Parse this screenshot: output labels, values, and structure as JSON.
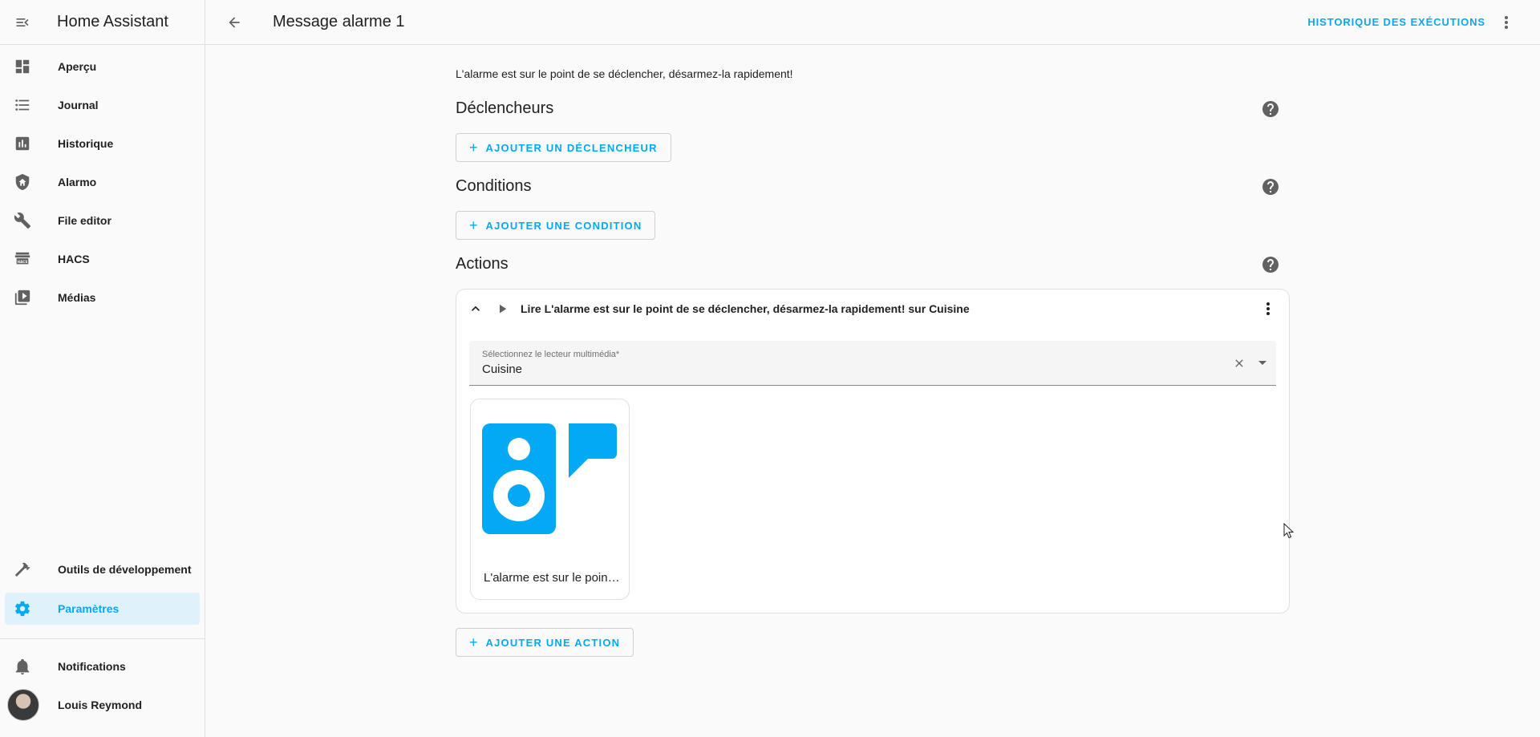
{
  "app": {
    "title": "Home Assistant"
  },
  "sidebar": {
    "items": [
      {
        "label": "Aperçu",
        "icon": "dashboard-icon"
      },
      {
        "label": "Journal",
        "icon": "list-icon"
      },
      {
        "label": "Historique",
        "icon": "chart-icon"
      },
      {
        "label": "Alarmo",
        "icon": "shield-home-icon"
      },
      {
        "label": "File editor",
        "icon": "wrench-icon"
      },
      {
        "label": "HACS",
        "icon": "hacs-store-icon"
      },
      {
        "label": "Médias",
        "icon": "play-box-icon"
      }
    ],
    "dev_tools": {
      "label": "Outils de développement",
      "icon": "hammer-icon"
    },
    "settings": {
      "label": "Paramètres",
      "icon": "gear-icon",
      "active": true
    },
    "notifications": {
      "label": "Notifications",
      "icon": "bell-icon"
    },
    "user": {
      "label": "Louis Reymond"
    }
  },
  "header": {
    "title": "Message alarme 1",
    "history_label": "HISTORIQUE DES EXÉCUTIONS"
  },
  "main": {
    "description": "L'alarme est sur le point de se déclencher, désarmez-la rapidement!",
    "triggers": {
      "heading": "Déclencheurs",
      "add_label": "AJOUTER UN DÉCLENCHEUR"
    },
    "conditions": {
      "heading": "Conditions",
      "add_label": "AJOUTER UNE CONDITION"
    },
    "actions": {
      "heading": "Actions",
      "add_label": "AJOUTER UNE ACTION",
      "card": {
        "title": "Lire L'alarme est sur le point de se déclencher, désarmez-la rapidement! sur Cuisine",
        "field_label": "Sélectionnez le lecteur multimédia*",
        "field_value": "Cuisine",
        "media_caption": "L'alarme est sur le point de se déclencher, désarmez-la rapidement!"
      }
    }
  },
  "colors": {
    "accent": "#03a9f4",
    "icon": "#44739e",
    "active_bg": "#dff1fb"
  }
}
